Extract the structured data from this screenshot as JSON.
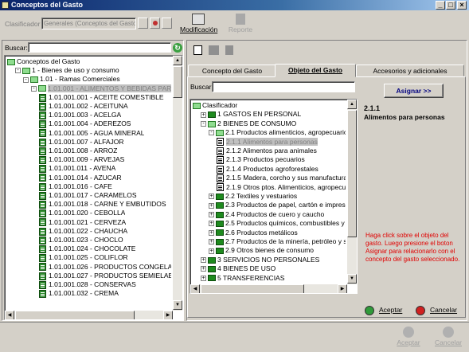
{
  "window": {
    "title": "Conceptos del Gasto",
    "min": "_",
    "max": "□",
    "close": "×"
  },
  "toolbar": {
    "clasificador_label": "Clasificador",
    "clasificador_value": "Generales (Conceptos del Gasto)",
    "modificacion_label": "Modificación",
    "reporte_label": "Reporte"
  },
  "left": {
    "buscar_label": "Buscar:",
    "buscar_value": "",
    "tree": [
      {
        "label": "Conceptos del Gasto",
        "indent": 0,
        "icon": "folder-open",
        "exp": ""
      },
      {
        "label": "1 - Bienes de uso y consumo",
        "indent": 1,
        "icon": "folder-open",
        "exp": "-"
      },
      {
        "label": "1.01 - Ramas Comerciales",
        "indent": 2,
        "icon": "folder-open",
        "exp": "-"
      },
      {
        "label": "1.01.001 - ALIMENTOS Y BEBIDAS PARA PE",
        "indent": 3,
        "icon": "folder-open",
        "exp": "-",
        "selected": true
      },
      {
        "label": "1.01.001.001 - ACEITE COMESTIBLE",
        "indent": 4,
        "icon": "doc-green"
      },
      {
        "label": "1.01.001.002 - ACEITUNA",
        "indent": 4,
        "icon": "doc-green"
      },
      {
        "label": "1.01.001.003 - ACELGA",
        "indent": 4,
        "icon": "doc-green"
      },
      {
        "label": "1.01.001.004 - ADEREZOS",
        "indent": 4,
        "icon": "doc-green"
      },
      {
        "label": "1.01.001.005 - AGUA MINERAL",
        "indent": 4,
        "icon": "doc-green"
      },
      {
        "label": "1.01.001.007 - ALFAJOR",
        "indent": 4,
        "icon": "doc-green"
      },
      {
        "label": "1.01.001.008 - ARROZ",
        "indent": 4,
        "icon": "doc-green"
      },
      {
        "label": "1.01.001.009 - ARVEJAS",
        "indent": 4,
        "icon": "doc-green"
      },
      {
        "label": "1.01.001.011 - AVENA",
        "indent": 4,
        "icon": "doc-green"
      },
      {
        "label": "1.01.001.014 - AZUCAR",
        "indent": 4,
        "icon": "doc-green"
      },
      {
        "label": "1.01.001.016 - CAFE",
        "indent": 4,
        "icon": "doc-green"
      },
      {
        "label": "1.01.001.017 - CARAMELOS",
        "indent": 4,
        "icon": "doc-green"
      },
      {
        "label": "1.01.001.018 - CARNE Y EMBUTIDOS",
        "indent": 4,
        "icon": "doc-green"
      },
      {
        "label": "1.01.001.020 - CEBOLLA",
        "indent": 4,
        "icon": "doc-green"
      },
      {
        "label": "1.01.001.021 - CERVEZA",
        "indent": 4,
        "icon": "doc-green"
      },
      {
        "label": "1.01.001.022 - CHAUCHA",
        "indent": 4,
        "icon": "doc-green"
      },
      {
        "label": "1.01.001.023 - CHOCLO",
        "indent": 4,
        "icon": "doc-green"
      },
      {
        "label": "1.01.001.024 - CHOCOLATE",
        "indent": 4,
        "icon": "doc-green"
      },
      {
        "label": "1.01.001.025 - COLIFLOR",
        "indent": 4,
        "icon": "doc-green"
      },
      {
        "label": "1.01.001.026 - PRODUCTOS CONGELADO",
        "indent": 4,
        "icon": "doc-green"
      },
      {
        "label": "1.01.001.027 - PRODUCTOS SEMIELABOI",
        "indent": 4,
        "icon": "doc-green"
      },
      {
        "label": "1.01.001.028 - CONSERVAS",
        "indent": 4,
        "icon": "doc-green"
      },
      {
        "label": "1.01.001.032 - CREMA",
        "indent": 4,
        "icon": "doc-green"
      }
    ]
  },
  "right": {
    "tabs": [
      "Concepto del Gasto",
      "Objeto del Gasto",
      "Accesorios y adicionales"
    ],
    "active_tab": 1,
    "buscar_label": "Buscar:",
    "buscar_value": "",
    "asignar_label": "Asignar >>",
    "tree": [
      {
        "label": "Clasificador",
        "indent": 0,
        "icon": "folder-open",
        "exp": ""
      },
      {
        "label": "1 GASTOS EN PERSONAL",
        "indent": 1,
        "icon": "folder",
        "exp": "+"
      },
      {
        "label": "2 BIENES DE CONSUMO",
        "indent": 1,
        "icon": "folder-open",
        "exp": "-"
      },
      {
        "label": "2.1 Productos alimenticios, agropecuarios y for",
        "indent": 2,
        "icon": "folder-open",
        "exp": "-"
      },
      {
        "label": "2.1.1 Alimentos para personas",
        "indent": 3,
        "icon": "doc-white",
        "selected": true
      },
      {
        "label": "2.1.2 Alimentos para animales",
        "indent": 3,
        "icon": "doc-white"
      },
      {
        "label": "2.1.3 Productos pecuarios",
        "indent": 3,
        "icon": "doc-white"
      },
      {
        "label": "2.1.4 Productos agroforestales",
        "indent": 3,
        "icon": "doc-white"
      },
      {
        "label": "2.1.5 Madera, corcho y sus manufacturas",
        "indent": 3,
        "icon": "doc-white"
      },
      {
        "label": "2.1.9 Otros ptos. Alimenticios, agropecuario",
        "indent": 3,
        "icon": "doc-white"
      },
      {
        "label": "2.2 Textiles y vestuarios",
        "indent": 2,
        "icon": "folder",
        "exp": "+"
      },
      {
        "label": "2.3 Productos de papel, cartón e impresos",
        "indent": 2,
        "icon": "folder",
        "exp": "+"
      },
      {
        "label": "2.4 Productos de cuero y caucho",
        "indent": 2,
        "icon": "folder",
        "exp": "+"
      },
      {
        "label": "2.5 Productos químicos, combustibles y lubrica",
        "indent": 2,
        "icon": "folder",
        "exp": "+"
      },
      {
        "label": "2.6 Productos metálicos",
        "indent": 2,
        "icon": "folder",
        "exp": "+"
      },
      {
        "label": "2.7 Productos de la minería, petróleo y sus der",
        "indent": 2,
        "icon": "folder",
        "exp": "+"
      },
      {
        "label": "2.9 Otros bienes de consumo",
        "indent": 2,
        "icon": "folder",
        "exp": "+"
      },
      {
        "label": "3 SERVICIOS NO PERSONALES",
        "indent": 1,
        "icon": "folder",
        "exp": "+"
      },
      {
        "label": "4 BIENES DE USO",
        "indent": 1,
        "icon": "folder",
        "exp": "+"
      },
      {
        "label": "5 TRANSFERENCIAS",
        "indent": 1,
        "icon": "folder",
        "exp": "+"
      }
    ],
    "detail_code": "2.1.1",
    "detail_name": "Alimentos para personas",
    "hint": "Haga click sobre el objeto del gasto. Luego presione el boton Asignar para relacionarlo con el concepto del gasto seleccionado.",
    "aceptar_label": "Aceptar",
    "cancelar_label": "Cancelar"
  },
  "footer": {
    "aceptar_label": "Aceptar",
    "cancelar_label": "Cancelar"
  }
}
